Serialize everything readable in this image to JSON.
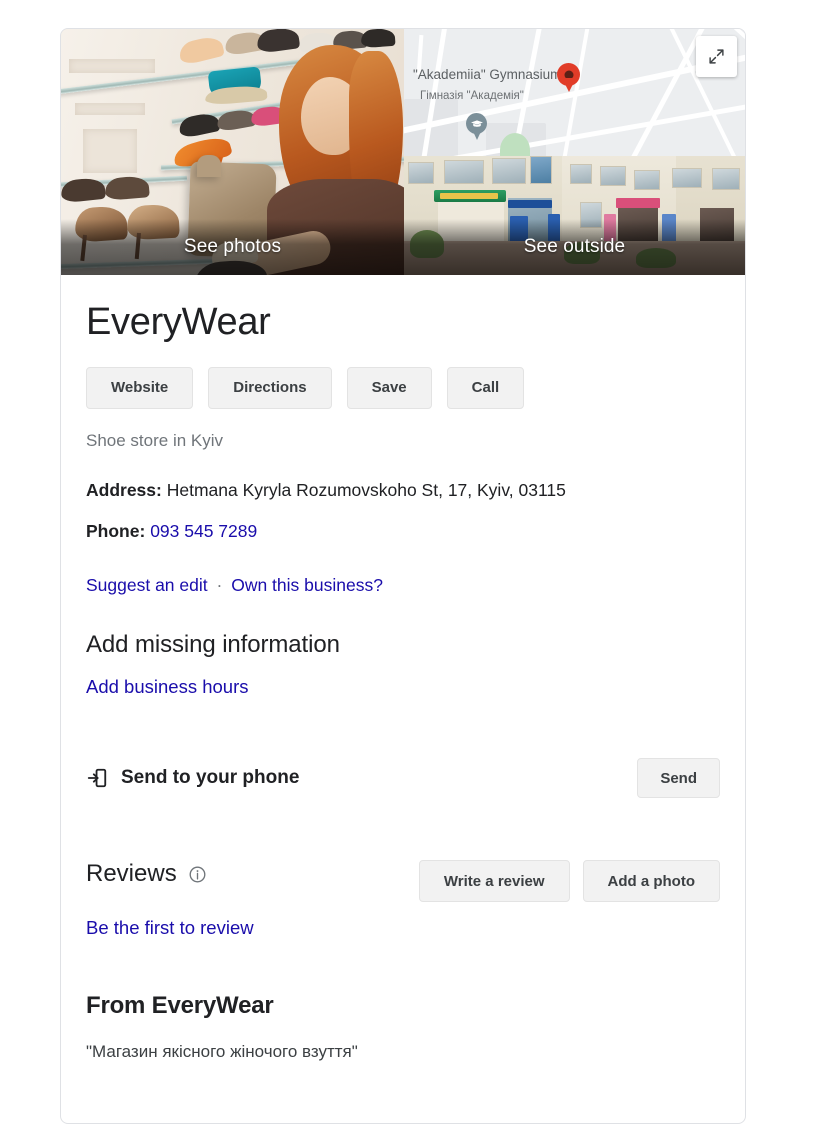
{
  "media": {
    "photo_label": "See photos",
    "street_label": "See outside",
    "expand_icon": "expand-icon",
    "map": {
      "label_main": "\"Akademiia\" Gymnasium",
      "label_sub": "Гімназія \"Академія\"",
      "pin_icon": "map-pin-icon",
      "school_icon": "school-graduation-cap-icon"
    }
  },
  "business": {
    "name": "EveryWear",
    "category": "Shoe store in Kyiv",
    "address_label": "Address:",
    "address_value": "Hetmana Kyryla Rozumovskoho St, 17, Kyiv, 03115",
    "phone_label": "Phone:",
    "phone_value": "093 545 7289"
  },
  "actions": {
    "website": "Website",
    "directions": "Directions",
    "save": "Save",
    "call": "Call"
  },
  "edit_links": {
    "suggest": "Suggest an edit",
    "separator": "·",
    "own": "Own this business?"
  },
  "missing_info": {
    "heading": "Add missing information",
    "add_hours": "Add business hours"
  },
  "send_to_phone": {
    "label": "Send to your phone",
    "button": "Send",
    "icon": "send-to-device-icon"
  },
  "reviews": {
    "heading": "Reviews",
    "info_icon": "info-icon",
    "write_review": "Write a review",
    "add_photo": "Add a photo",
    "be_first": "Be the first to review"
  },
  "from_business": {
    "heading": "From EveryWear",
    "quote": "\"Магазин якісного жіночого взуття\""
  },
  "colors": {
    "link": "#1a0dab",
    "text_primary": "#202124",
    "text_secondary": "#70757a",
    "button_bg": "#f2f2f2",
    "card_border": "#dfe1e5",
    "pin_red": "#e13c28"
  }
}
